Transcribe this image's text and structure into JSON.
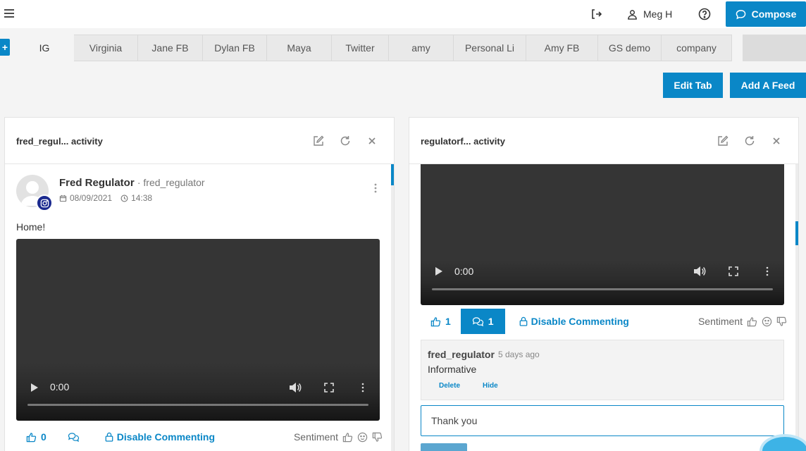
{
  "topbar": {
    "user_name": "Meg H",
    "compose_label": "Compose"
  },
  "tabs": {
    "add_label": "+",
    "items": [
      "IG",
      "Virginia",
      "Jane FB",
      "Dylan FB",
      "Maya",
      "Twitter",
      "amy",
      "Personal Li",
      "Amy FB",
      "GS demo",
      "company"
    ],
    "active": "IG"
  },
  "actions": {
    "edit_tab": "Edit Tab",
    "add_feed": "Add A Feed"
  },
  "left_panel": {
    "title": "fred_regul... activity",
    "post": {
      "author": "Fred Regulator",
      "handle": "· fred_regulator",
      "date": "08/09/2021",
      "time": "14:38",
      "text": "Home!",
      "video_time": "0:00",
      "likes": "0",
      "disable_commenting": "Disable Commenting",
      "sentiment_label": "Sentiment"
    }
  },
  "right_panel": {
    "title": "regulatorf... activity",
    "post": {
      "video_time": "0:00",
      "likes": "1",
      "comments_count": "1",
      "disable_commenting": "Disable Commenting",
      "sentiment_label": "Sentiment"
    },
    "comment": {
      "author": "fred_regulator",
      "time": "5 days ago",
      "text": "Informative",
      "delete_label": "Delete",
      "hide_label": "Hide"
    },
    "reply_value": "Thank you"
  },
  "colors": {
    "accent": "#0a87c7",
    "instagram_badge": "#1b2a8f"
  }
}
